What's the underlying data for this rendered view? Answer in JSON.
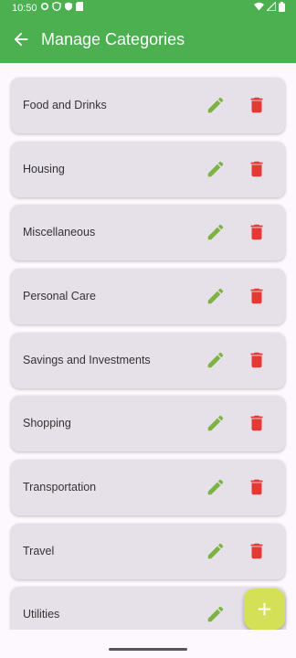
{
  "status_bar": {
    "time": "10:50"
  },
  "app_bar": {
    "title": "Manage Categories",
    "back_icon": "arrow-back-icon"
  },
  "categories": [
    {
      "label": "Food and Drinks"
    },
    {
      "label": "Housing"
    },
    {
      "label": "Miscellaneous"
    },
    {
      "label": "Personal Care"
    },
    {
      "label": "Savings and Investments"
    },
    {
      "label": "Shopping"
    },
    {
      "label": "Transportation"
    },
    {
      "label": "Travel"
    },
    {
      "label": "Utilities"
    }
  ],
  "icons": {
    "edit": "pencil-icon",
    "delete": "trash-icon",
    "add": "plus-icon"
  },
  "colors": {
    "app_bar": "#4caf50",
    "card": "#e6e1e9",
    "edit": "#7cb342",
    "delete": "#e53935",
    "fab": "#d4e157"
  }
}
